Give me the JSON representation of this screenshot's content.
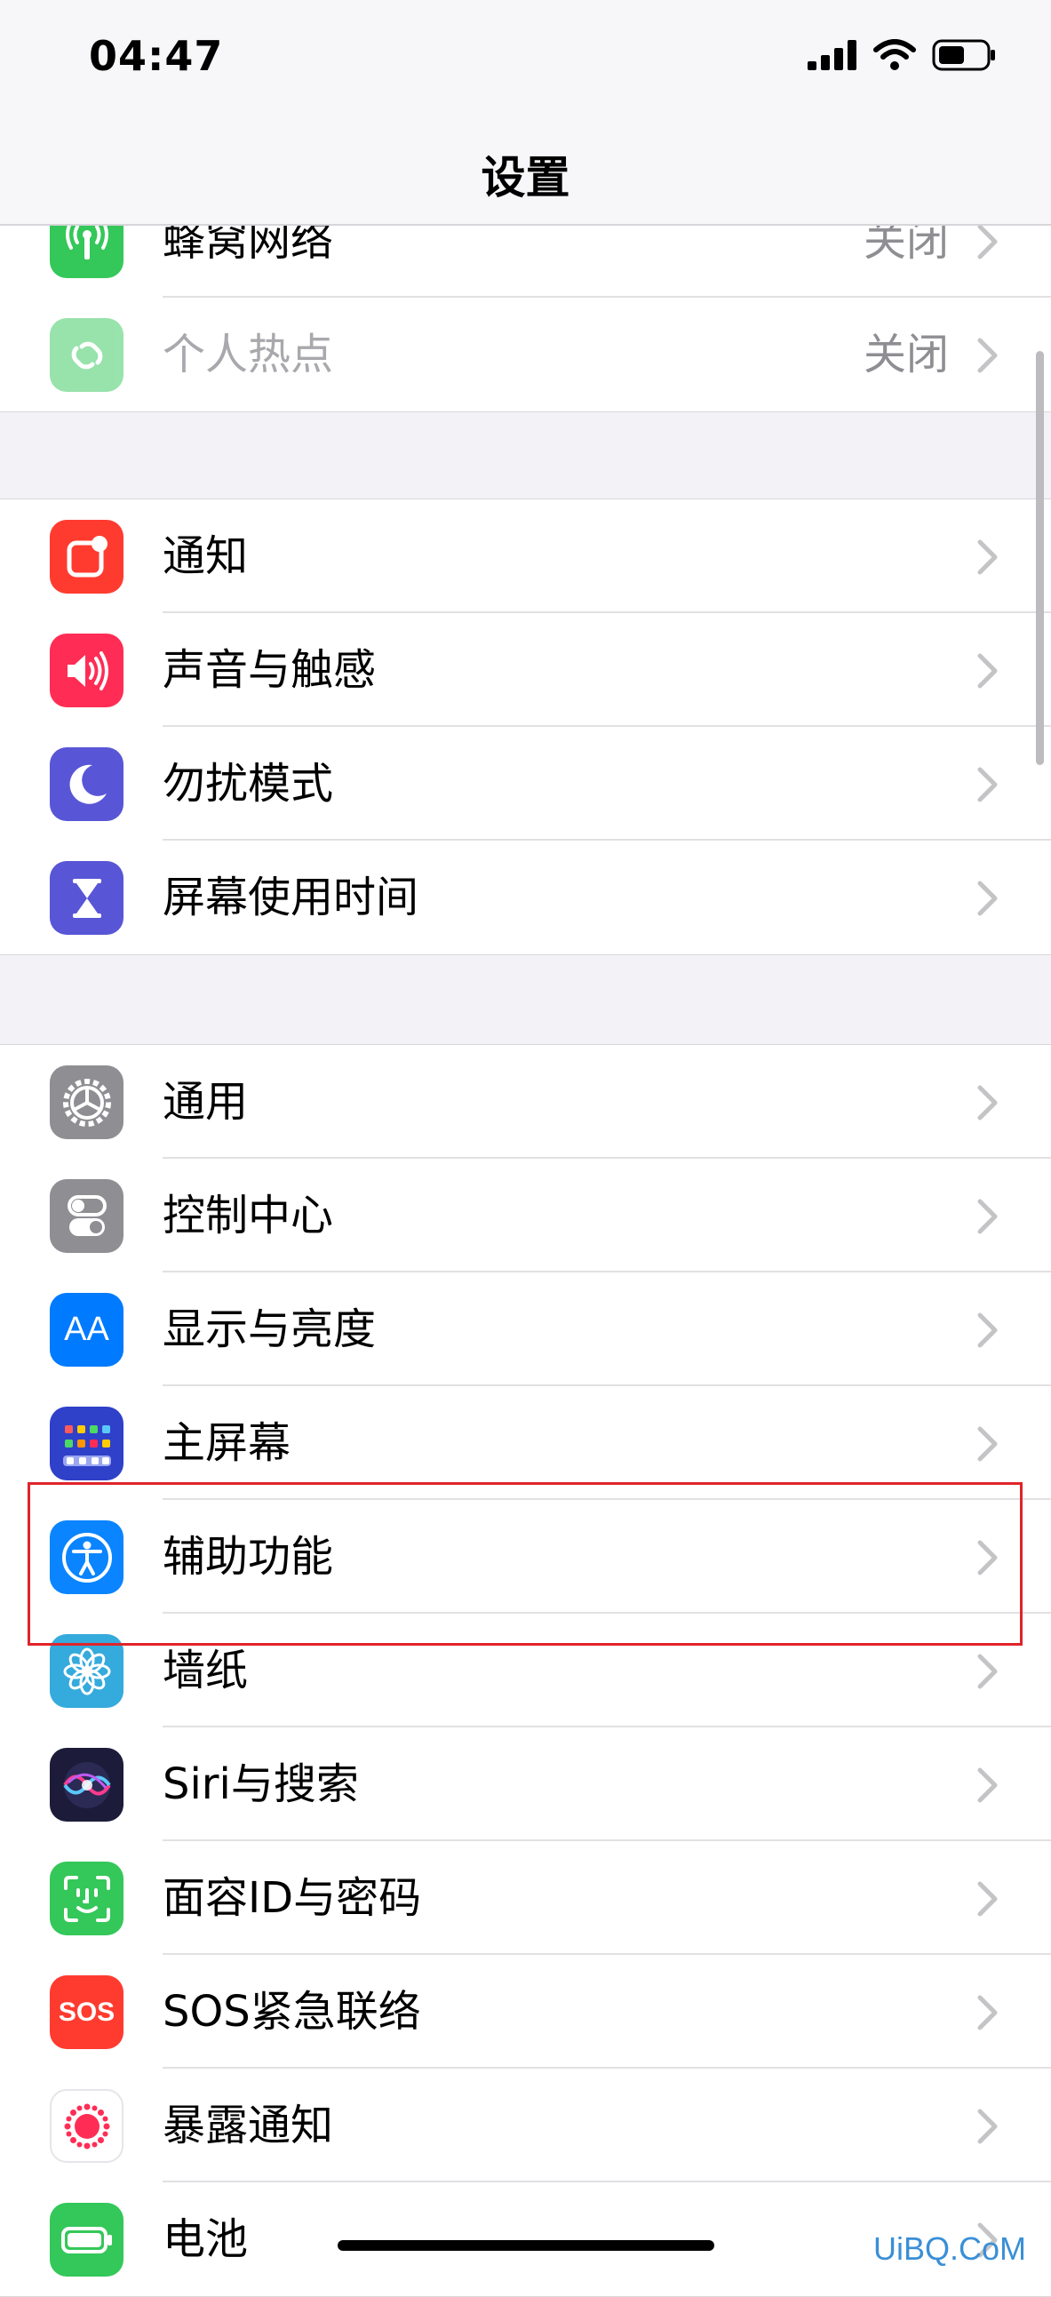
{
  "status": {
    "time": "04:47"
  },
  "nav": {
    "title": "设置"
  },
  "sections": [
    [
      {
        "label": "蜂窝网络",
        "value": "关闭",
        "icon": "cellular-icon",
        "color": "#34c759"
      },
      {
        "label": "个人热点",
        "value": "关闭",
        "icon": "hotspot-icon",
        "color": "#34c759"
      }
    ],
    [
      {
        "label": "通知",
        "icon": "notifications-icon",
        "color": "#ff3b30"
      },
      {
        "label": "声音与触感",
        "icon": "sound-icon",
        "color": "#ff2d55"
      },
      {
        "label": "勿扰模式",
        "icon": "moon-icon",
        "color": "#5856d6"
      },
      {
        "label": "屏幕使用时间",
        "icon": "hourglass-icon",
        "color": "#5856d6"
      }
    ],
    [
      {
        "label": "通用",
        "icon": "gear-icon",
        "color": "#8e8e93"
      },
      {
        "label": "控制中心",
        "icon": "toggles-icon",
        "color": "#8e8e93"
      },
      {
        "label": "显示与亮度",
        "icon": "display-icon",
        "color": "#007aff",
        "glyph": "AA"
      },
      {
        "label": "主屏幕",
        "icon": "home-screen-icon",
        "color": "#2f40c9"
      },
      {
        "label": "辅助功能",
        "icon": "accessibility-icon",
        "color": "#0a84ff"
      },
      {
        "label": "墙纸",
        "icon": "wallpaper-icon",
        "color": "#35aadc"
      },
      {
        "label": "Siri与搜索",
        "icon": "siri-icon",
        "color": "#1c1c3a"
      },
      {
        "label": "面容ID与密码",
        "icon": "face-id-icon",
        "color": "#34c759"
      },
      {
        "label": "SOS紧急联络",
        "icon": "sos-icon",
        "color": "#ff3b30",
        "glyph": "SOS"
      },
      {
        "label": "暴露通知",
        "icon": "exposure-icon",
        "color": "#ffffff"
      },
      {
        "label": "电池",
        "icon": "battery-icon",
        "color": "#34c759"
      }
    ]
  ],
  "watermark": "UiBQ.CoM"
}
